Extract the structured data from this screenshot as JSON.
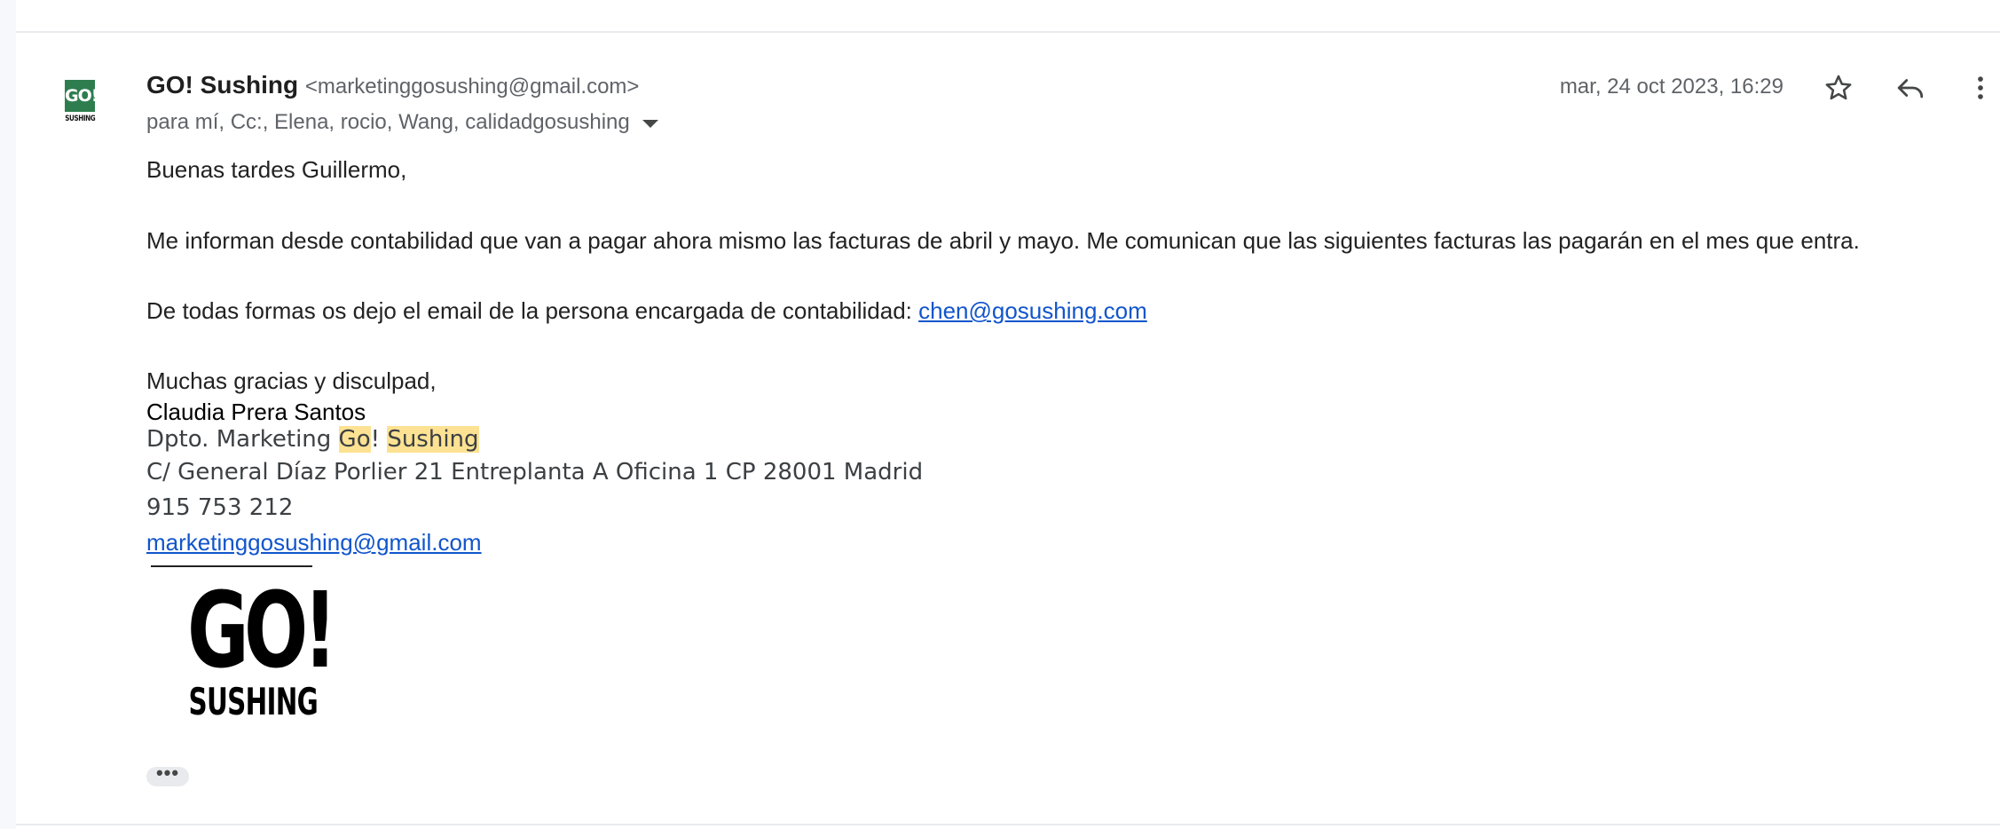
{
  "message": {
    "sender_name": "GO! Sushing",
    "sender_email": "<marketinggosushing@gmail.com>",
    "recipients": "para mí, Cc:, Elena, rocio, Wang, calidadgosushing",
    "date": "mar, 24 oct 2023, 16:29",
    "avatar_text": "GO!",
    "avatar_subtext": "SUSHING"
  },
  "body": {
    "greeting": "Buenas tardes Guillermo,",
    "paragraph1": "Me informan desde contabilidad que van a pagar ahora mismo las facturas de abril y mayo. Me comunican que las siguientes facturas las pagarán en el mes que entra.",
    "paragraph2_prefix": "De todas formas os dejo el email de la persona encargada de contabilidad: ",
    "paragraph2_link": "chen@gosushing.com",
    "thanks": "Muchas gracias y disculpad,",
    "signer": "Claudia Prera Santos"
  },
  "signature": {
    "dept_prefix": "Dpto. Marketing ",
    "dept_hl1": "Go",
    "dept_bang": "!",
    "dept_space": " ",
    "dept_hl2": "Sushing",
    "address": "C/ General Díaz Porlier 21 Entreplanta A Oficina 1 CP 28001 Madrid",
    "phone": "915 753 212",
    "email": "marketinggosushing@gmail.com",
    "logo_top": "GO!",
    "logo_bottom": "SUSHING"
  },
  "actions": {
    "more_content": "•••"
  },
  "colors": {
    "link": "#1155cc",
    "highlight": "#fde293",
    "avatar_green": "#2e7d4f"
  },
  "icons": [
    "star-icon",
    "reply-icon",
    "more-vert-icon",
    "dropdown-caret-icon"
  ]
}
